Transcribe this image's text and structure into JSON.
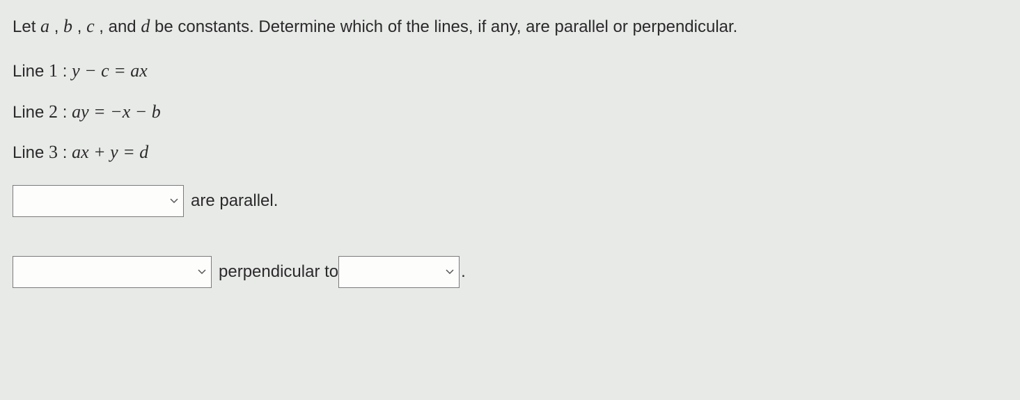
{
  "intro": {
    "part1": "Let ",
    "a": "a",
    "sep1": " , ",
    "b": "b",
    "sep2": " , ",
    "c": "c",
    "sep3": " , and ",
    "d": "d",
    "part2": " be constants. Determine which of the lines, if any, are parallel or perpendicular."
  },
  "lines": {
    "line1": {
      "label": "Line ",
      "num": "1",
      "colon": " : ",
      "eq": "y − c = ax"
    },
    "line2": {
      "label": "Line  ",
      "num": "2",
      "colon": " :  ",
      "eq": "ay = −x − b"
    },
    "line3": {
      "label": "Line  ",
      "num": "3",
      "colon": " :  ",
      "eq": "ax + y = d"
    }
  },
  "answers": {
    "parallel_text": " are parallel.",
    "perpendicular_text": " perpendicular to ",
    "period": ".",
    "select1_value": "",
    "select2_value": "",
    "select3_value": ""
  }
}
